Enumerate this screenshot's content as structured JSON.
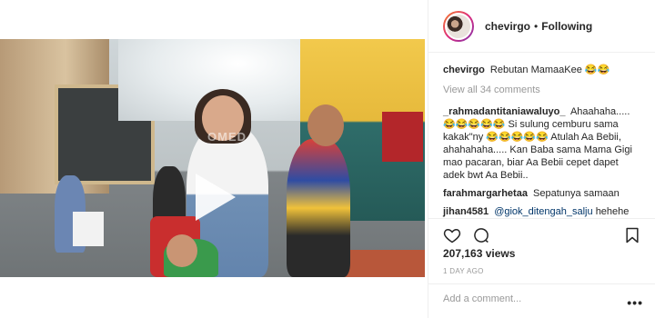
{
  "post": {
    "username": "chevirgo",
    "follow_status": "Following",
    "separator": "•"
  },
  "video": {
    "watermark": "OMED"
  },
  "caption": {
    "user": "chevirgo",
    "text": "Rebutan MamaaKee 😂😂"
  },
  "view_all_comments": "View all 34 comments",
  "comments": [
    {
      "user": "_rahmadantitaniawaluyo_",
      "text": "Ahaahaha.....😂😂😂😂😂 Si sulung cemburu sama kakak\"ny 😂😂😂😂😂 Atulah Aa Bebii, ahahahaha..... Kan Baba sama Mama Gigi mao pacaran, biar Aa Bebii cepet dapet adek bwt Aa Bebii.."
    },
    {
      "user": "farahmargarhetaa",
      "text": "Sepatunya samaan"
    },
    {
      "user": "jihan4581",
      "text": "@giok_ditengah_salju hehehe",
      "mention": "@giok_ditengah_salju",
      "rest": "hehehe"
    }
  ],
  "stats": {
    "views": "207,163 views",
    "time": "1 DAY AGO"
  },
  "add_comment": {
    "placeholder": "Add a comment...",
    "more": "•••"
  },
  "icons": {
    "heart": "heart-icon",
    "comment": "comment-icon",
    "bookmark": "bookmark-icon",
    "play": "play-icon"
  }
}
